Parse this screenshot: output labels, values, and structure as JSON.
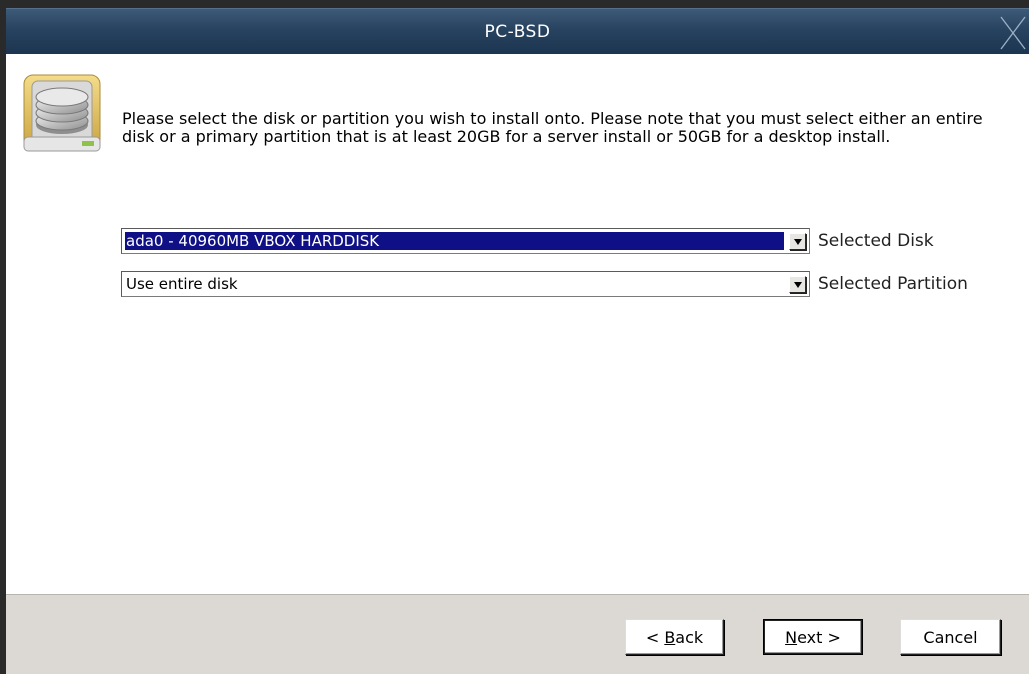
{
  "window": {
    "title": "PC-BSD"
  },
  "icons": {
    "disk": "hard-disk-icon",
    "close": "close-icon"
  },
  "instructions": "Please select the disk or partition you wish to install onto. Please note that you must select either an entire disk or a primary partition that is at least 20GB for a server install or 50GB for a desktop install.",
  "disk_select": {
    "value": "ada0 - 40960MB VBOX HARDDISK",
    "label": "Selected Disk"
  },
  "partition_select": {
    "value": "Use entire disk",
    "label": "Selected Partition"
  },
  "buttons": {
    "back_pre": "< ",
    "back_key": "B",
    "back_rest": "ack",
    "next_key": "N",
    "next_rest": "ext >",
    "cancel": "Cancel"
  },
  "colors": {
    "titlebar": "#284360",
    "selection": "#0f0f86",
    "footer": "#dcd9d4"
  }
}
